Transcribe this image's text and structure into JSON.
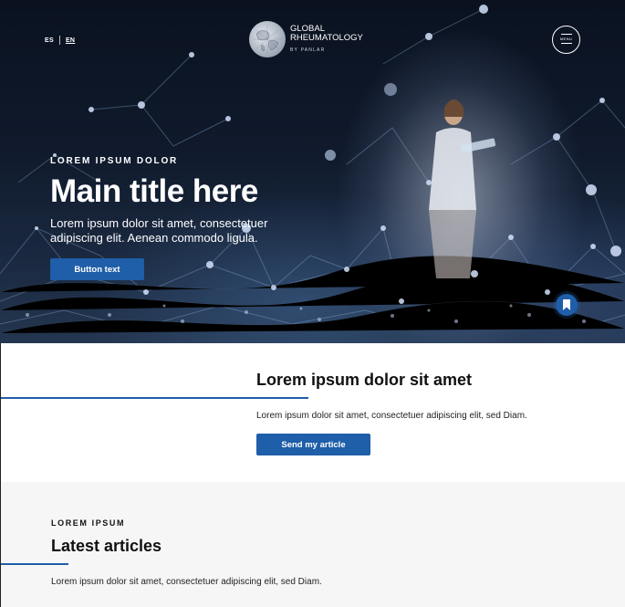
{
  "header": {
    "languages": [
      {
        "code": "ES",
        "active": false
      },
      {
        "code": "EN",
        "active": true
      }
    ],
    "logo": {
      "line1": "GLOBAL",
      "line2": "RHEUMATOLOGY",
      "line3": "BY PANLAR"
    },
    "menu_label": "MENU"
  },
  "hero": {
    "eyebrow": "LOREM IPSUM DOLOR",
    "title": "Main title here",
    "text": "Lorem ipsum dolor sit amet, consectetuer adipiscing elit. Aenean commodo ligula.",
    "button_label": "Button text",
    "bookmark_icon": "bookmark-icon"
  },
  "submit_section": {
    "title": "Lorem ipsum dolor sit amet",
    "text": "Lorem ipsum dolor sit amet, consectetuer adipiscing elit, sed Diam.",
    "button_label": "Send my article"
  },
  "articles_section": {
    "eyebrow": "LOREM IPSUM",
    "title": "Latest articles",
    "text": "Lorem ipsum dolor sit amet, consectetuer adipiscing elit, sed Diam."
  },
  "colors": {
    "accent": "#1f5ea8",
    "hero_dark": "#0a1220",
    "section_gray": "#f6f6f6"
  }
}
